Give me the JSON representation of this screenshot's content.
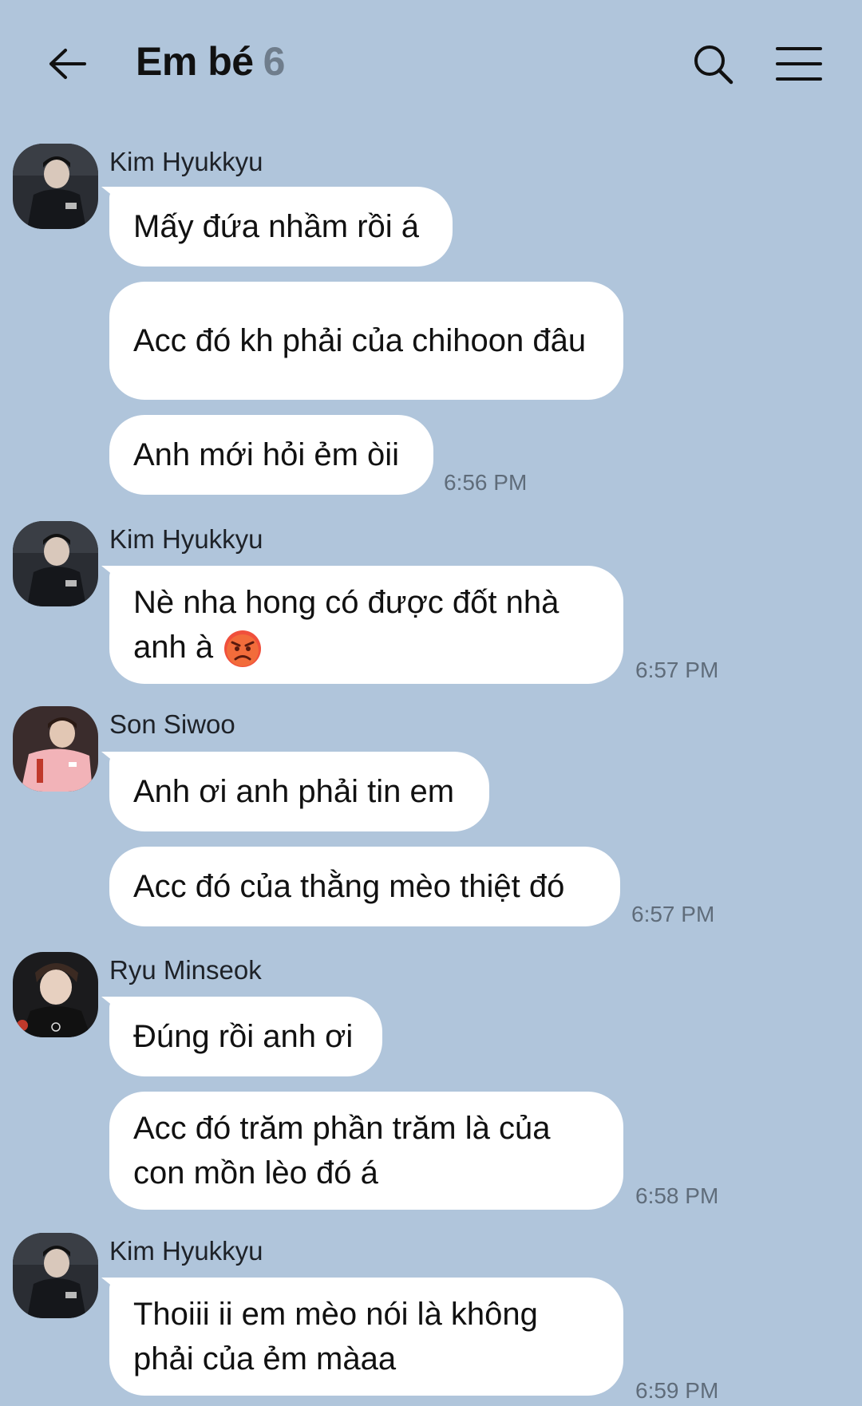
{
  "header": {
    "title": "Em bé",
    "member_count": "6",
    "back_icon": "arrow-left-icon",
    "search_icon": "search-icon",
    "menu_icon": "menu-icon"
  },
  "messages": [
    {
      "sender": "Kim Hyukkyu",
      "avatar": "avatar-kim-hyukkyu",
      "bubbles": [
        "Mấy đứa nhầm rồi á",
        "Acc đó kh phải của chihoon đâu",
        "Anh mới hỏi ẻm òii"
      ],
      "time": "6:56 PM"
    },
    {
      "sender": "Kim Hyukkyu",
      "avatar": "avatar-kim-hyukkyu",
      "bubbles": [
        "Nè nha hong có được đốt nhà anh à"
      ],
      "emoji": "angry-face-emoji",
      "time": "6:57 PM"
    },
    {
      "sender": "Son Siwoo",
      "avatar": "avatar-son-siwoo",
      "bubbles": [
        "Anh ơi anh phải tin em",
        "Acc đó của thằng mèo thiệt đó"
      ],
      "time": "6:57 PM"
    },
    {
      "sender": "Ryu Minseok",
      "avatar": "avatar-ryu-minseok",
      "bubbles": [
        "Đúng rồi anh ơi",
        "Acc đó trăm phần trăm là của con mồn lèo đó á"
      ],
      "time": "6:58 PM"
    },
    {
      "sender": "Kim Hyukkyu",
      "avatar": "avatar-kim-hyukkyu",
      "bubbles": [
        "Thoiii ii em mèo nói là không phải của ẻm màaa"
      ],
      "time": "6:59 PM"
    }
  ]
}
